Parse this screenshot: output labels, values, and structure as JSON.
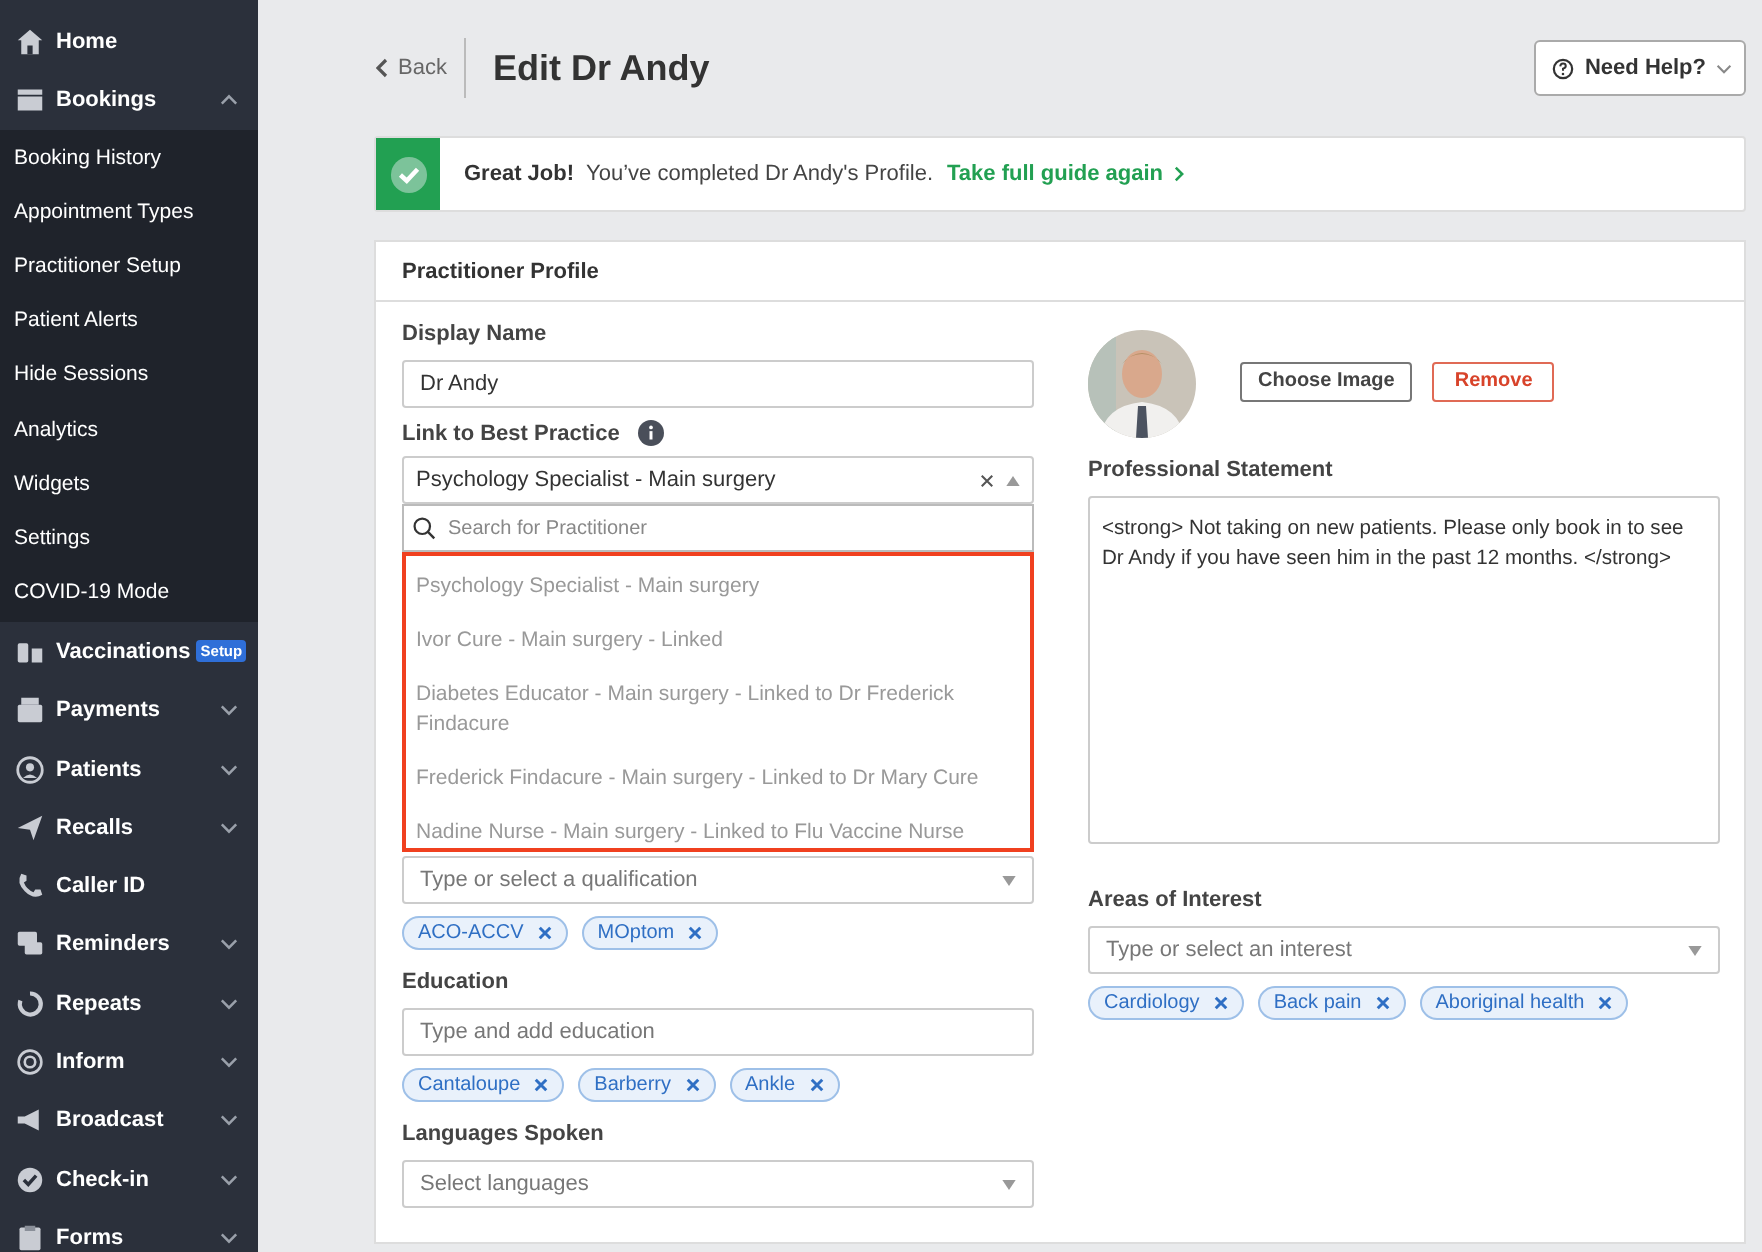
{
  "sidebar": {
    "items": [
      {
        "label": "Home"
      },
      {
        "label": "Bookings",
        "expanded": true,
        "children": [
          {
            "label": "Booking History"
          },
          {
            "label": "Appointment Types"
          },
          {
            "label": "Practitioner Setup"
          },
          {
            "label": "Patient Alerts"
          },
          {
            "label": "Hide Sessions"
          },
          {
            "label": "Analytics"
          },
          {
            "label": "Widgets"
          },
          {
            "label": "Settings"
          },
          {
            "label": "COVID-19 Mode"
          }
        ]
      },
      {
        "label": "Vaccinations",
        "badge": "Setup"
      },
      {
        "label": "Payments",
        "expanded": false
      },
      {
        "label": "Patients",
        "expanded": false
      },
      {
        "label": "Recalls",
        "expanded": false
      },
      {
        "label": "Caller ID"
      },
      {
        "label": "Reminders",
        "expanded": false
      },
      {
        "label": "Repeats",
        "expanded": false
      },
      {
        "label": "Inform",
        "expanded": false
      },
      {
        "label": "Broadcast",
        "expanded": false
      },
      {
        "label": "Check-in",
        "expanded": false
      },
      {
        "label": "Forms",
        "expanded": false
      }
    ]
  },
  "header": {
    "back": "Back",
    "title": "Edit Dr Andy",
    "help": "Need Help?"
  },
  "alert": {
    "title": "Great Job!",
    "message": "You’ve completed Dr Andy's Profile.",
    "link": "Take full guide again"
  },
  "card": {
    "title": "Practitioner Profile"
  },
  "form": {
    "display_name": {
      "label": "Display Name",
      "value": "Dr Andy"
    },
    "link": {
      "label": "Link to Best Practice",
      "value": "Psychology Specialist - Main surgery",
      "dropdown": {
        "search_placeholder": "Search for Practitioner",
        "highlighted": true,
        "options": [
          {
            "label": "Psychology Specialist - Main surgery"
          },
          {
            "label": "Ivor Cure - Main surgery - Linked"
          },
          {
            "label": "Diabetes Educator - Main surgery - Linked to Dr Frederick Findacure"
          },
          {
            "label": "Frederick Findacure - Main surgery - Linked to Dr Mary Cure"
          },
          {
            "label": "Nadine Nurse - Main surgery - Linked to Flu Vaccine Nurse"
          }
        ]
      }
    },
    "qualifications": {
      "placeholder": "Type or select a qualification",
      "tags": [
        "ACO-ACCV",
        "MOptom"
      ]
    },
    "education": {
      "label": "Education",
      "placeholder": "Type and add education",
      "tags": [
        "Cantaloupe",
        "Barberry",
        "Ankle"
      ]
    },
    "languages": {
      "label": "Languages Spoken",
      "placeholder": "Select languages"
    },
    "image_buttons": [
      {
        "label": "Choose Image",
        "kind": "default"
      },
      {
        "label": "Remove",
        "kind": "danger"
      }
    ],
    "statement": {
      "label": "Professional Statement",
      "value": "<strong> Not taking on new patients. Please only book in to see Dr Andy if you have seen him in the past 12 months. </strong>"
    },
    "interests": {
      "label": "Areas of Interest",
      "placeholder": "Type or select an interest",
      "tags": [
        "Cardiology",
        "Back pain",
        "Aboriginal health"
      ]
    }
  }
}
